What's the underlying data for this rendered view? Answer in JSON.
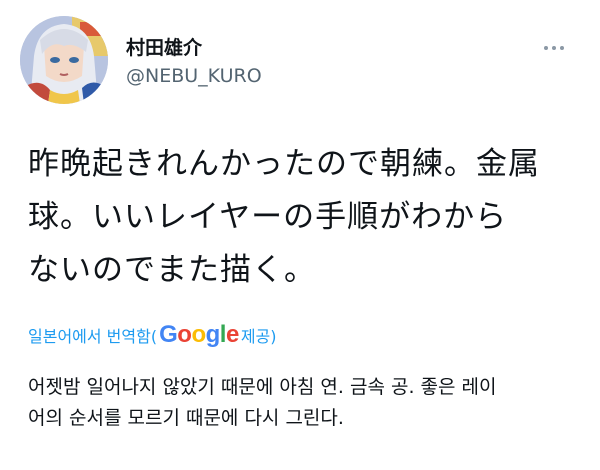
{
  "tweet": {
    "author": {
      "display_name": "村田雄介",
      "handle": "@NEBU_KURO",
      "avatar_icon": "avatar-illustration"
    },
    "more_icon": "more-options-icon",
    "text_lines": [
      "昨晩起きれんかったので朝練。金属",
      "球。いいレイヤーの手順がわから",
      "ないのでまた描く。"
    ],
    "translation": {
      "prefix": "일본어에서 번역함(",
      "provider_letters": [
        "G",
        "o",
        "o",
        "g",
        "l",
        "e"
      ],
      "suffix": " 제공)",
      "text_lines": [
        "어젯밤 일어나지 않았기 때문에 아침 연. 금속 공. 좋은 레이",
        "어의 순서를 모르기 때문에 다시 그린다."
      ]
    }
  },
  "colors": {
    "text_primary": "#0f1419",
    "text_secondary": "#536471",
    "link": "#1d9bf0",
    "google_blue": "#4285f4",
    "google_red": "#ea4335",
    "google_yellow": "#fbbc05",
    "google_green": "#34a853"
  }
}
